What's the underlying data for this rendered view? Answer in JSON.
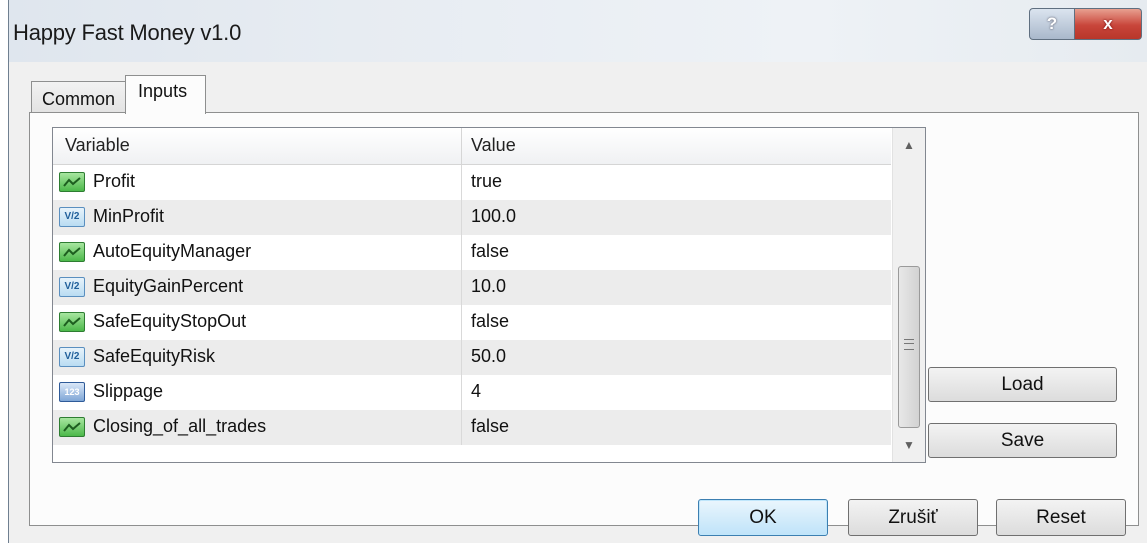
{
  "window": {
    "title": "Happy Fast Money v1.0",
    "help_glyph": "?",
    "close_glyph": "x"
  },
  "tabs": [
    {
      "label": "Common"
    },
    {
      "label": "Inputs"
    }
  ],
  "grid": {
    "headers": {
      "variable": "Variable",
      "value": "Value"
    },
    "rows": [
      {
        "icon": "bool-icon",
        "variable": "Profit",
        "value": "true"
      },
      {
        "icon": "double-icon",
        "icon_text": "V/2",
        "variable": "MinProfit",
        "value": "100.0"
      },
      {
        "icon": "bool-icon",
        "variable": "AutoEquityManager",
        "value": "false"
      },
      {
        "icon": "double-icon",
        "icon_text": "V/2",
        "variable": "EquityGainPercent",
        "value": "10.0"
      },
      {
        "icon": "bool-icon",
        "variable": "SafeEquityStopOut",
        "value": "false"
      },
      {
        "icon": "double-icon",
        "icon_text": "V/2",
        "variable": "SafeEquityRisk",
        "value": "50.0"
      },
      {
        "icon": "int-icon",
        "icon_text": "123",
        "variable": "Slippage",
        "value": "4"
      },
      {
        "icon": "bool-icon",
        "variable": "Closing_of_all_trades",
        "value": "false"
      }
    ]
  },
  "side_buttons": {
    "load": "Load",
    "save": "Save"
  },
  "footer_buttons": {
    "ok": "OK",
    "cancel": "Zrušiť",
    "reset": "Reset"
  }
}
